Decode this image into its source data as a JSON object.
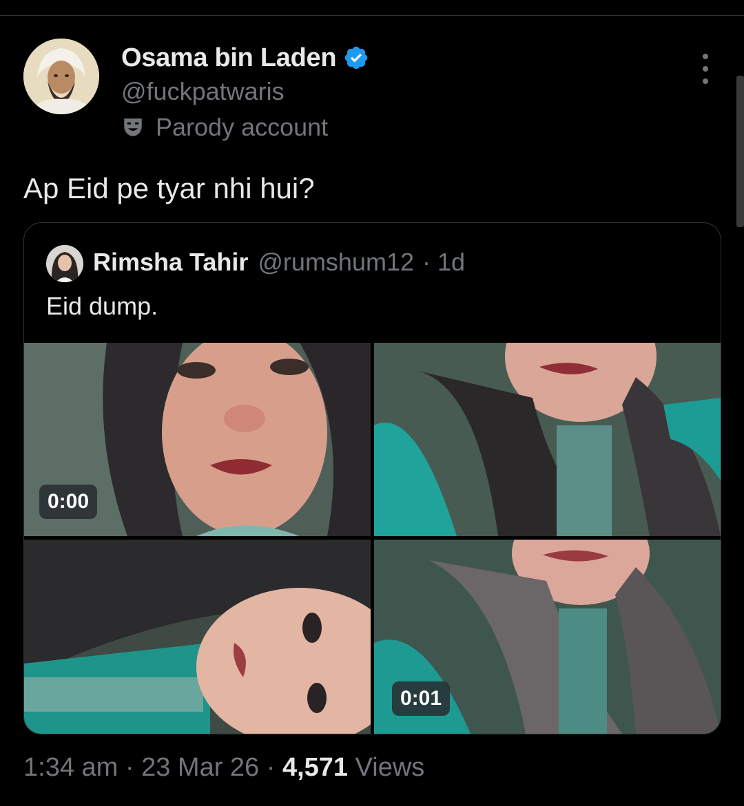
{
  "tweet": {
    "author_name": "Osama bin Laden",
    "author_handle": "@fuckpatwaris",
    "label": "Parody account",
    "text": "Ap Eid pe tyar nhi hui?",
    "time": "1:34 am",
    "date": "23 Mar 26",
    "views_count": "4,571",
    "views_label": "Views",
    "separator": "·"
  },
  "quoted": {
    "author_name": "Rimsha Tahir",
    "author_handle": "@rumshum12",
    "age": "1d",
    "separator": "·",
    "text": "Eid dump.",
    "media": [
      {
        "type": "video",
        "duration": "0:00"
      },
      {
        "type": "image"
      },
      {
        "type": "image"
      },
      {
        "type": "video",
        "duration": "0:01"
      }
    ]
  },
  "colors": {
    "background": "#000000",
    "text_primary": "#e7e9ea",
    "text_secondary": "#71767b",
    "verified": "#1d9bf0",
    "border": "#2f3336"
  },
  "icons": {
    "verified": "verified-badge-icon",
    "parody": "theater-mask-icon",
    "more": "more-vertical-icon"
  }
}
